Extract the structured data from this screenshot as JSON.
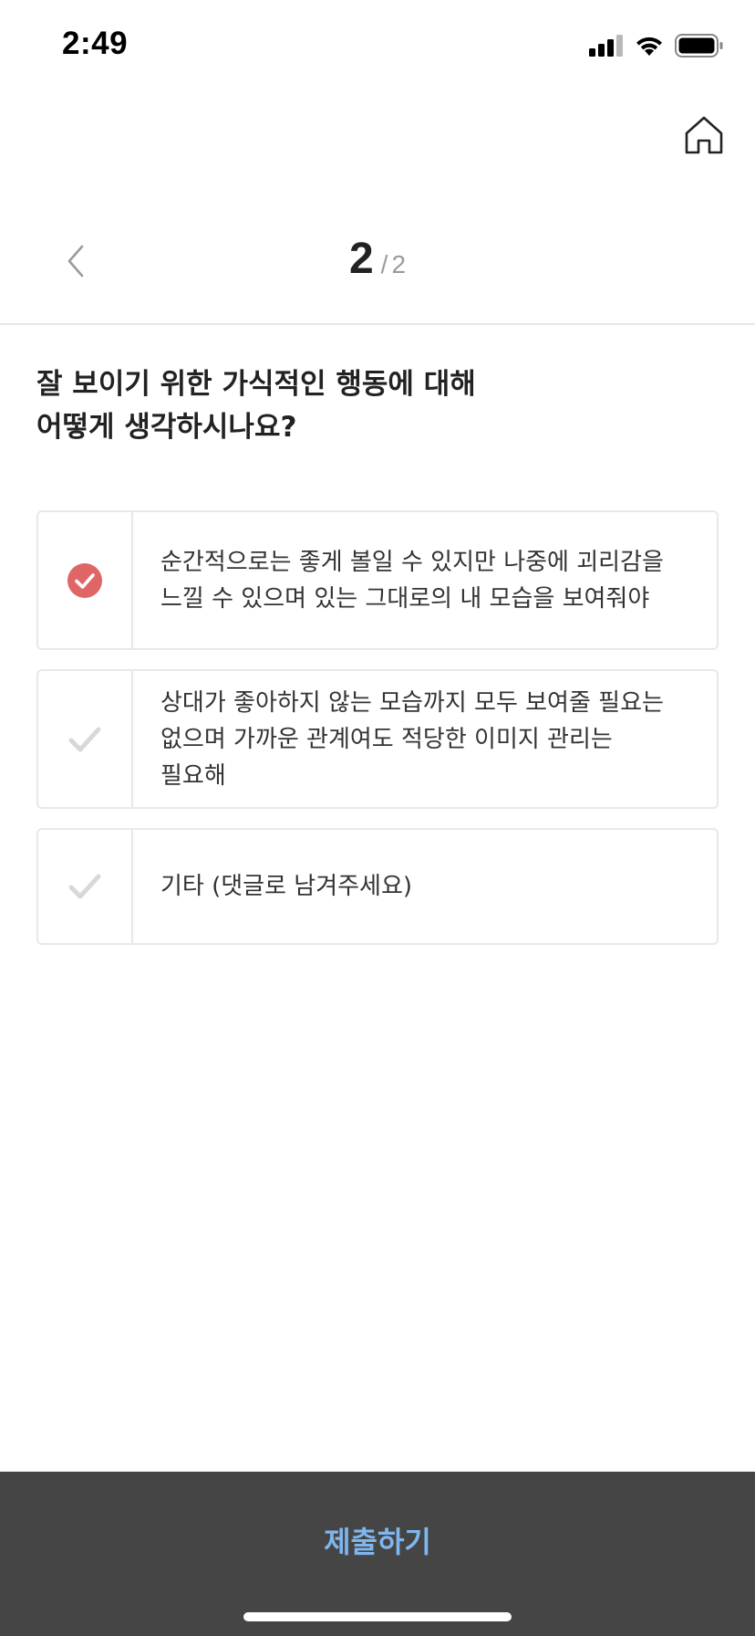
{
  "status_bar": {
    "time": "2:49",
    "icons": [
      "cellular-signal-icon",
      "wifi-icon",
      "battery-icon"
    ]
  },
  "header": {
    "home_icon": "home-icon",
    "back_icon": "chevron-left-icon",
    "progress": {
      "current": "2",
      "separator": "/",
      "total": "2"
    }
  },
  "question": "잘 보이기 위한 가식적인 행동에 대해\n어떻게 생각하시나요?",
  "options": [
    {
      "text": "순간적으로는 좋게 볼일 수 있지만 나중에 괴리감을\n느낄 수 있으며 있는 그대로의 내 모습을 보여줘야",
      "selected": true
    },
    {
      "text": "상대가 좋아하지 않는 모습까지 모두 보여줄 필요는\n없으며 가까운 관계여도 적당한 이미지 관리는\n필요해",
      "selected": false
    },
    {
      "text": "기타 (댓글로 남겨주세요)",
      "selected": false
    }
  ],
  "submit": {
    "label": "제출하기"
  },
  "colors": {
    "selected_check": "#e06666",
    "unselected_check": "#d8d8d8",
    "submit_bar": "#454545",
    "submit_text": "#7fb6ee"
  }
}
